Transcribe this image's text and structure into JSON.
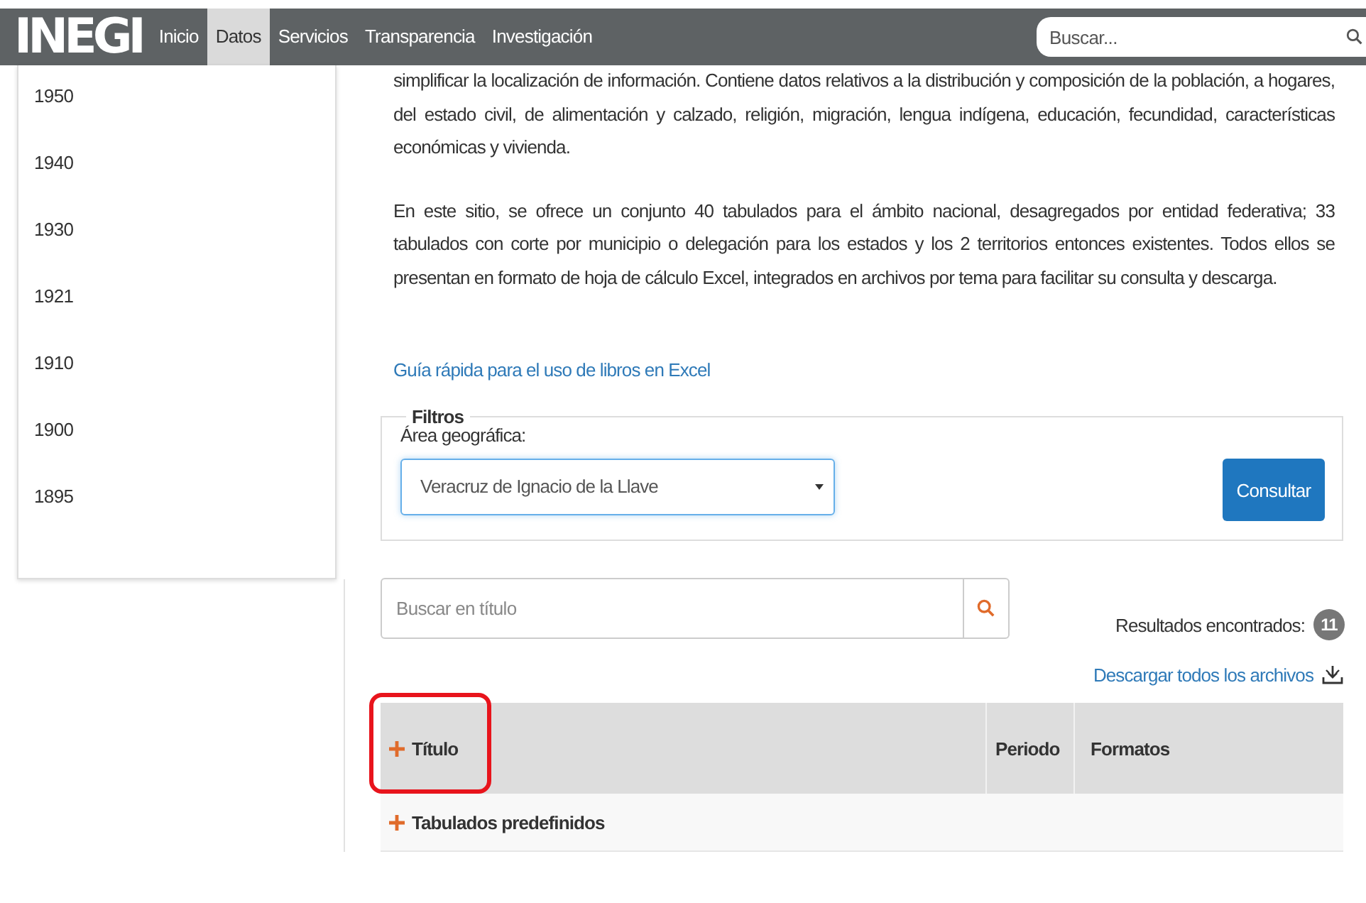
{
  "header": {
    "logo": "INEGI",
    "nav": [
      {
        "label": "Inicio",
        "selected": false
      },
      {
        "label": "Datos",
        "selected": true
      },
      {
        "label": "Servicios",
        "selected": false
      },
      {
        "label": "Transparencia",
        "selected": false
      },
      {
        "label": "Investigación",
        "selected": false
      }
    ],
    "search": {
      "placeholder": "Buscar..."
    }
  },
  "sidebar": {
    "items": [
      "1950",
      "1940",
      "1930",
      "1921",
      "1910",
      "1900",
      "1895"
    ]
  },
  "content": {
    "paragraphs": [
      "simplificar la localización de información. Contiene datos relativos a la distribución y composición de la población, a hogares, del estado civil, de alimentación y calzado, religión, migración, lengua indígena, educación, fecundidad, características económicas y vivienda.",
      "En este sitio, se ofrece un conjunto 40 tabulados para el ámbito nacional, desagregados por entidad federativa; 33 tabulados con corte por municipio o delegación para los estados y los 2 territorios entonces existentes. Todos ellos se presentan en formato de hoja de cálculo Excel, integrados en archivos por tema para facilitar su consulta y descarga."
    ],
    "guide_link": "Guía rápida para el uso de libros en Excel",
    "filters": {
      "legend": "Filtros",
      "label": "Área geográfica:",
      "value": "Veracruz de Ignacio de la Llave",
      "button": "Consultar"
    },
    "title_search": {
      "placeholder": "Buscar en título"
    },
    "results": {
      "label": "Resultados encontrados:",
      "count": "11"
    },
    "download_all": "Descargar todos los archivos",
    "table": {
      "columns": [
        {
          "label": "Título",
          "expandable": true,
          "highlighted": true
        },
        {
          "label": "Periodo",
          "expandable": false,
          "highlighted": false
        },
        {
          "label": "Formatos",
          "expandable": false,
          "highlighted": false
        }
      ],
      "rows": [
        {
          "label": "Tabulados predefinidos",
          "expanded": false
        }
      ]
    }
  }
}
